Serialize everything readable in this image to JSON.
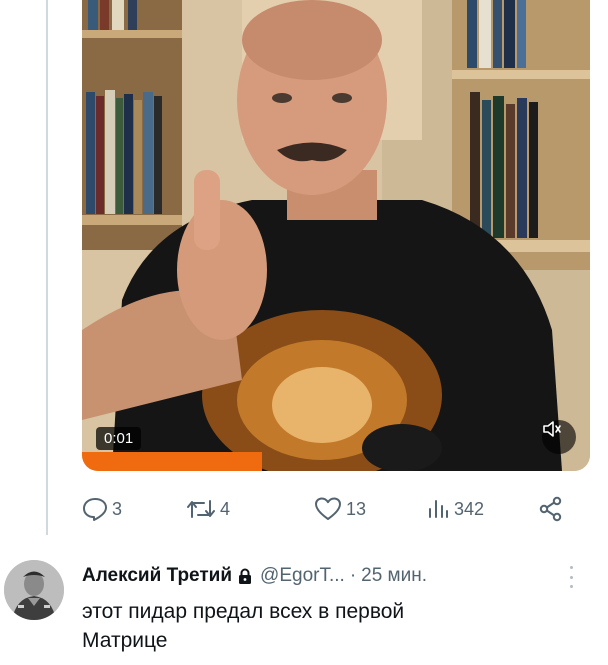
{
  "video": {
    "timestamp": "0:01",
    "mute_icon": "speaker-muted-icon"
  },
  "actions": {
    "replies": "3",
    "reposts": "4",
    "likes": "13",
    "views": "342",
    "icons": [
      "reply-icon",
      "repost-icon",
      "like-icon",
      "views-icon",
      "share-icon"
    ]
  },
  "reply": {
    "name": "Алексий Третий",
    "handle": "@EgorT...",
    "separator": "·",
    "time": "25 мин.",
    "text_line1": "этот пидар предал всех в первой",
    "text_line2": "Матрице"
  },
  "colors": {
    "muted_text": "#536471",
    "thread_line": "#cfd9de",
    "primary_text": "#0f1419"
  }
}
